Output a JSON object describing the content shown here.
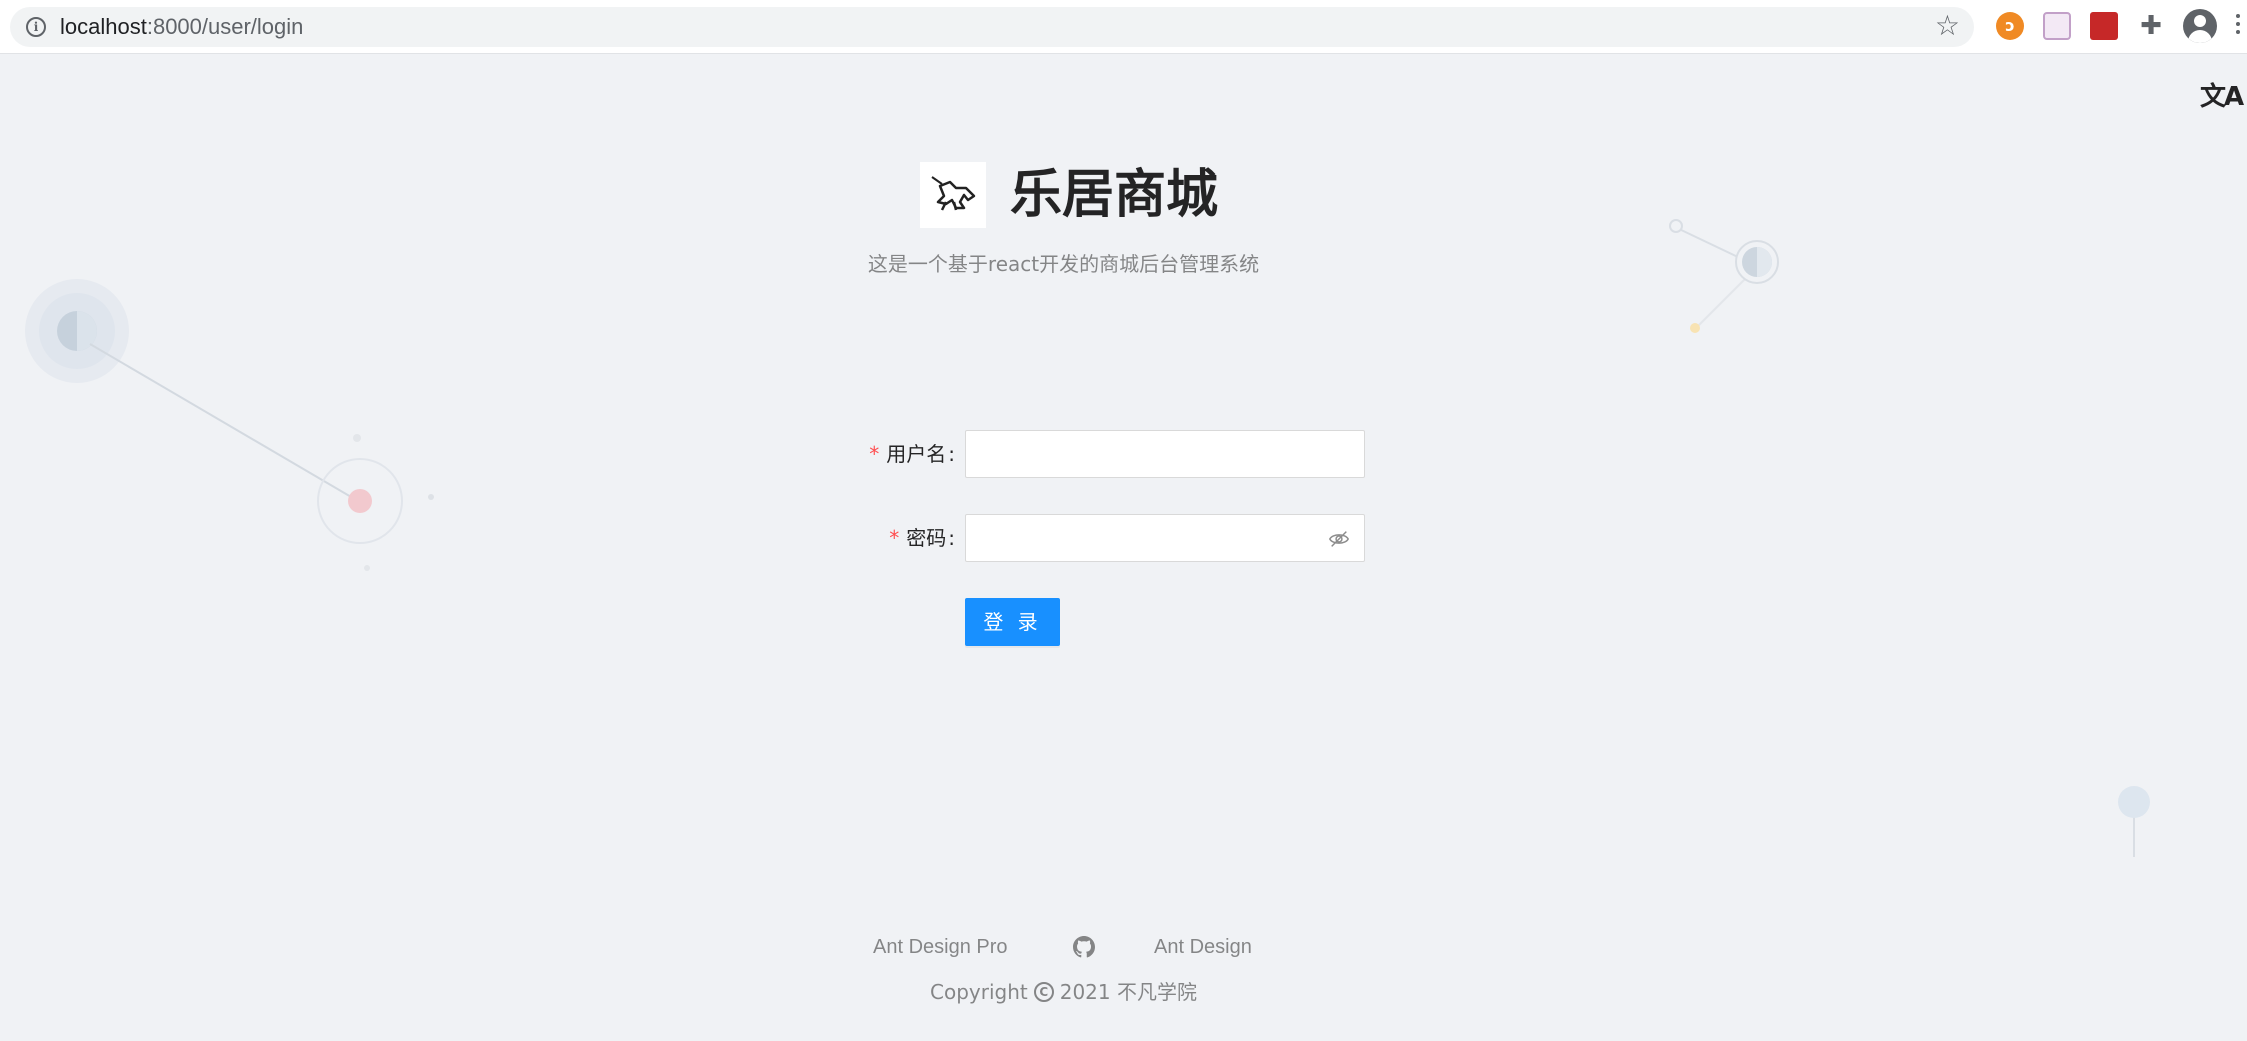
{
  "browser": {
    "url_host": "localhost",
    "url_rest": ":8000/user/login",
    "star_icon": "star-icon"
  },
  "lang_switch": {
    "glyph": "文A",
    "icon": "translate-icon"
  },
  "header": {
    "title": "乐居商城",
    "subtitle": "这是一个基于react开发的商城后台管理系统",
    "logo_icon": "unicorn-logo"
  },
  "form": {
    "username": {
      "required_mark": "*",
      "label": "用户名",
      "colon": ":",
      "value": ""
    },
    "password": {
      "required_mark": "*",
      "label": "密码",
      "colon": ":",
      "value": "",
      "toggle_icon": "eye-invisible-icon"
    },
    "submit_label": "登 录"
  },
  "footer": {
    "links": [
      "Ant Design Pro",
      "Ant Design"
    ],
    "github_icon": "github-icon",
    "copyright_prefix": "Copyright",
    "copyright_suffix": "2021 不凡学院"
  },
  "colors": {
    "primary": "#1890ff",
    "required": "#ff4d4f",
    "background": "#f0f2f5"
  }
}
